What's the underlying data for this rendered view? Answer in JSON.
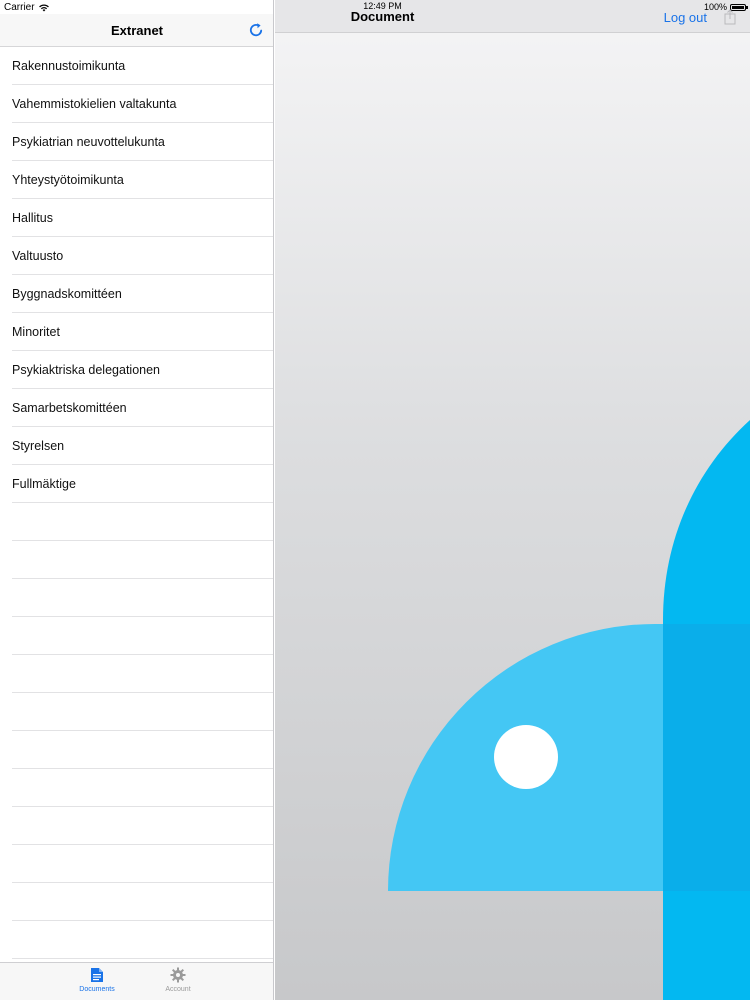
{
  "status": {
    "carrier": "Carrier",
    "time": "12:49 PM",
    "battery": "100%",
    "battery_level": 1.0
  },
  "master": {
    "title": "Extranet",
    "refresh_icon": "refresh-icon",
    "items": [
      {
        "label": "Rakennustoimikunta"
      },
      {
        "label": "Vahemmistokielien valtakunta"
      },
      {
        "label": "Psykiatrian neuvottelukunta"
      },
      {
        "label": "Yhteystyötoimikunta"
      },
      {
        "label": "Hallitus"
      },
      {
        "label": "Valtuusto"
      },
      {
        "label": "Byggnadskomittéen"
      },
      {
        "label": "Minoritet"
      },
      {
        "label": "Psykiaktriska delegationen"
      },
      {
        "label": "Samarbetskomittéen"
      },
      {
        "label": "Styrelsen"
      },
      {
        "label": "Fullmäktige"
      }
    ],
    "empty_rows": 12
  },
  "tabs": [
    {
      "label": "Documents",
      "icon": "document-icon",
      "selected": true
    },
    {
      "label": "Account",
      "icon": "gear-icon",
      "selected": false
    }
  ],
  "detail": {
    "title": "Document",
    "logout_label": "Log out",
    "share_icon": "share-icon"
  },
  "colors": {
    "accent": "#1a73e8",
    "shape_light": "#44c7f4",
    "shape_dark": "#03b8f1"
  }
}
